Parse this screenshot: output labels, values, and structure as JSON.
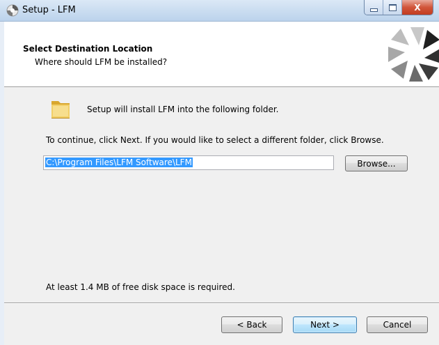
{
  "window": {
    "title": "Setup - LFM",
    "close_glyph": "X",
    "icons": {
      "app": "setup-icon",
      "minimize": "minimize-icon",
      "maximize": "maximize-icon",
      "close": "close-icon"
    }
  },
  "header": {
    "title": "Select Destination Location",
    "subtitle": "Where should LFM be installed?",
    "graphic": "spinner-wizard-icon"
  },
  "main": {
    "folder_icon": "folder-icon",
    "intro": "Setup will install LFM into the following folder.",
    "instruction": "To continue, click Next. If you would like to select a different folder, click Browse.",
    "path_value": "C:\\Program Files\\LFM Software\\LFM",
    "browse_label": "Browse...",
    "disk_space": "At least 1.4 MB of free disk space is required."
  },
  "footer": {
    "back_label": "< Back",
    "next_label": "Next >",
    "cancel_label": "Cancel"
  },
  "colors": {
    "selection": "#3399ff",
    "default_button_border": "#3c7fb1",
    "close_button": "#c9452a"
  }
}
